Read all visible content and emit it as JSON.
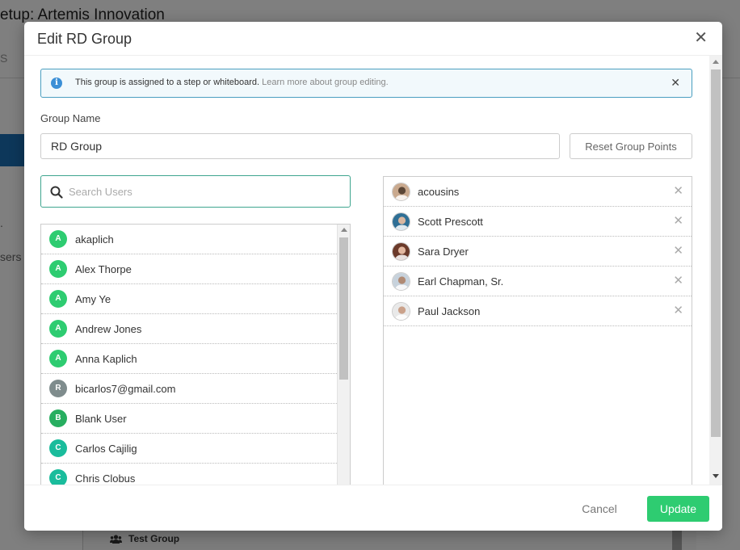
{
  "background": {
    "title": "etup: Artemis Innovation",
    "tab_fragment": "S",
    "mark_fragment": ".",
    "users_fragment": "sers",
    "test_group_label": "Test Group"
  },
  "modal": {
    "title": "Edit RD Group",
    "close_glyph": "✕"
  },
  "alert": {
    "message": "This group is assigned to a step or whiteboard.",
    "link_text": "Learn more about group editing.",
    "info_glyph": "i",
    "close_glyph": "✕"
  },
  "form": {
    "group_name_label": "Group Name",
    "group_name_value": "RD Group",
    "reset_button_label": "Reset Group Points",
    "search_placeholder": "Search Users"
  },
  "available_users": [
    {
      "initial": "A",
      "name": "akaplich",
      "color": "#2ecc71"
    },
    {
      "initial": "A",
      "name": "Alex Thorpe",
      "color": "#2ecc71"
    },
    {
      "initial": "A",
      "name": "Amy Ye",
      "color": "#2ecc71"
    },
    {
      "initial": "A",
      "name": "Andrew Jones",
      "color": "#2ecc71"
    },
    {
      "initial": "A",
      "name": "Anna Kaplich",
      "color": "#2ecc71"
    },
    {
      "initial": "R",
      "name": "bicarlos7@gmail.com",
      "color": "#7f8c8d"
    },
    {
      "initial": "B",
      "name": "Blank User",
      "color": "#27ae60"
    },
    {
      "initial": "C",
      "name": "Carlos Cajilig",
      "color": "#1abc9c"
    },
    {
      "initial": "C",
      "name": "Chris Clobus",
      "color": "#1abc9c"
    }
  ],
  "group_members": [
    {
      "name": "acousins",
      "avatar_bg": "#c9a98e",
      "avatar_fg": "#5a4636"
    },
    {
      "name": "Scott Prescott",
      "avatar_bg": "#2f6f95",
      "avatar_fg": "#d9b7a0"
    },
    {
      "name": "Sara Dryer",
      "avatar_bg": "#6b3a2a",
      "avatar_fg": "#e3b8a0"
    },
    {
      "name": "Earl Chapman, Sr.",
      "avatar_bg": "#c7d2dc",
      "avatar_fg": "#b08a74"
    },
    {
      "name": "Paul Jackson",
      "avatar_bg": "#e9e9e9",
      "avatar_fg": "#caa18a"
    }
  ],
  "member_remove_glyph": "✕",
  "footer": {
    "cancel_label": "Cancel",
    "update_label": "Update"
  },
  "colors": {
    "accent_green": "#2ecc71",
    "search_border": "#3fa58f",
    "alert_border": "#4a9ec0",
    "info_icon": "#3b8fd6"
  }
}
